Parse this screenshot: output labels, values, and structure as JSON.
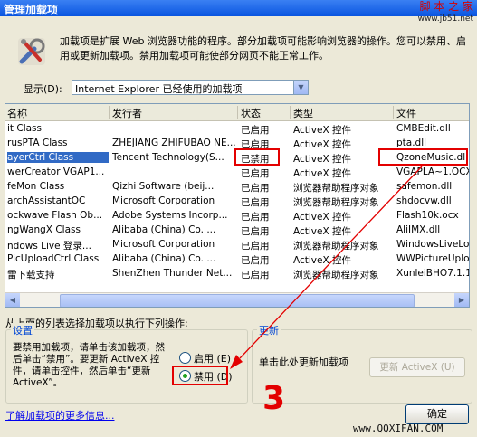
{
  "window": {
    "title": "管理加载项"
  },
  "watermark_top": {
    "text": "脚 本 之 家",
    "url": "www.jb51.net"
  },
  "description": "加载项是扩展 Web 浏览器功能的程序。部分加载项可能影响浏览器的操作。您可以禁用、启用或更新加载项。禁用加载项可能使部分网页不能正常工作。",
  "display": {
    "label": "显示(D):",
    "value": "Internet Explorer 已经使用的加载项"
  },
  "table": {
    "columns": [
      "名称",
      "发行者",
      "状态",
      "类型",
      "文件"
    ],
    "rows": [
      {
        "name": "it Class",
        "publisher": "",
        "status": "已启用",
        "type": "ActiveX 控件",
        "file": "CMBEdit.dll"
      },
      {
        "name": "rusPTA Class",
        "publisher": "ZHEJIANG ZHIFUBAO NE...",
        "status": "已启用",
        "type": "ActiveX 控件",
        "file": "pta.dll"
      },
      {
        "name": "ayerCtrl Class",
        "publisher": "Tencent Technology(S...",
        "status": "已禁用",
        "type": "ActiveX 控件",
        "file": "QzoneMusic.dll"
      },
      {
        "name": "werCreator VGAP1...",
        "publisher": "",
        "status": "已启用",
        "type": "ActiveX 控件",
        "file": "VGAPLA~1.OCX"
      },
      {
        "name": "feMon Class",
        "publisher": "Qizhi Software (beij...",
        "status": "已启用",
        "type": "浏览器帮助程序对象",
        "file": "safemon.dll"
      },
      {
        "name": "archAssistantOC",
        "publisher": "Microsoft Corporation",
        "status": "已启用",
        "type": "浏览器帮助程序对象",
        "file": "shdocvw.dll"
      },
      {
        "name": "ockwave Flash Ob...",
        "publisher": "Adobe Systems Incorp...",
        "status": "已启用",
        "type": "ActiveX 控件",
        "file": "Flash10k.ocx"
      },
      {
        "name": "ngWangX Class",
        "publisher": "Alibaba (China) Co. ...",
        "status": "已启用",
        "type": "ActiveX 控件",
        "file": "AliIMX.dll"
      },
      {
        "name": "ndows Live 登录...",
        "publisher": "Microsoft Corporation",
        "status": "已启用",
        "type": "浏览器帮助程序对象",
        "file": "WindowsLiveLog"
      },
      {
        "name": "PicUploadCtrl Class",
        "publisher": "Alibaba (China) Co. ...",
        "status": "已启用",
        "type": "ActiveX 控件",
        "file": "WWPictureUploa"
      },
      {
        "name": "雷下载支持",
        "publisher": "ShenZhen Thunder Net...",
        "status": "已启用",
        "type": "浏览器帮助程序对象",
        "file": "XunleiBHO7.1.1"
      }
    ]
  },
  "action_prompt": "从上面的列表选择加载项以执行下列操作:",
  "settings": {
    "legend": "设置",
    "text": "要禁用加载项，请单击该加载项，然后单击“禁用”。要更新 ActiveX 控件，请单击控件，然后单击“更新 ActiveX”。",
    "enable_label": "启用 (E)",
    "disable_label": "禁用 (D)"
  },
  "update": {
    "legend": "更新",
    "text": "单击此处更新加载项",
    "button_label": "更新 ActiveX (U)"
  },
  "learn_more_link": "了解加载项的更多信息...",
  "ok_button": "确定",
  "annotation_number": "3",
  "watermark_bottom": "www.QQXIFAN.COM",
  "colors": {
    "annotation_red": "#e30000",
    "selection": "#316ac5",
    "title_bar": "#0a55e0"
  }
}
